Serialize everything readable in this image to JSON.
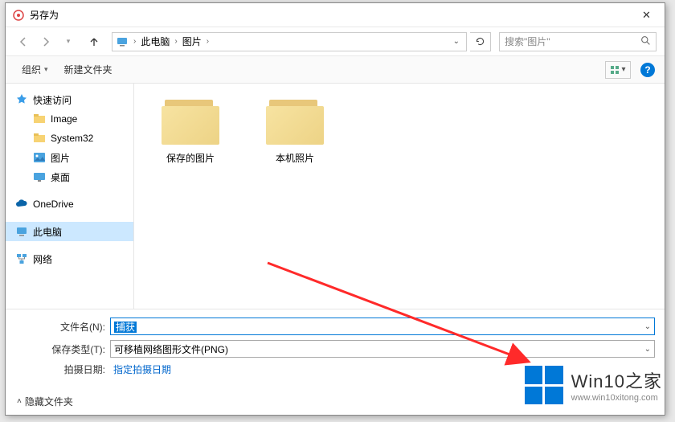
{
  "title": "另存为",
  "breadcrumb": {
    "root": "此电脑",
    "folder": "图片"
  },
  "search": {
    "placeholder": "搜索\"图片\""
  },
  "toolbar": {
    "organize": "组织",
    "new_folder": "新建文件夹"
  },
  "sidebar": {
    "quick_access": "快速访问",
    "items": [
      "Image",
      "System32",
      "图片",
      "桌面"
    ],
    "onedrive": "OneDrive",
    "this_pc": "此电脑",
    "network": "网络"
  },
  "folders": [
    {
      "label": "保存的图片"
    },
    {
      "label": "本机照片"
    }
  ],
  "form": {
    "filename_label": "文件名(N):",
    "filename_value": "捕获",
    "filetype_label": "保存类型(T):",
    "filetype_value": "可移植网络图形文件(PNG)",
    "date_label": "拍摄日期:",
    "date_value": "指定拍摄日期"
  },
  "footer": {
    "hide_folders": "隐藏文件夹"
  },
  "watermark": {
    "brand": "Win10",
    "suffix": "之家",
    "url": "www.win10xitong.com"
  }
}
